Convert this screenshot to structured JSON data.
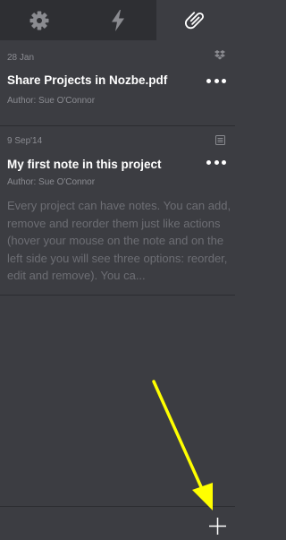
{
  "tabs": [
    {
      "icon": "gear-icon",
      "active": false
    },
    {
      "icon": "lightning-icon",
      "active": false
    },
    {
      "icon": "paperclip-icon",
      "active": true
    }
  ],
  "notes": [
    {
      "date": "28 Jan",
      "type_icon": "dropbox-icon",
      "title": "Share Projects in Nozbe.pdf",
      "author": "Author: Sue O'Connor"
    },
    {
      "date": "9 Sep'14",
      "type_icon": "note-icon",
      "title": "My first note in this project",
      "author": "Author: Sue O'Connor",
      "body": "Every project can have notes. You can add, remove and reorder them just like actions (hover your mouse on the note and on the left side you will see three options: reorder, edit and remove). You ca..."
    }
  ],
  "colors": {
    "background": "#3c3d42",
    "tabbar": "#2e2f33",
    "muted_text": "#8b8c92",
    "body_text": "#6d6e74",
    "annotation_arrow": "#ffff00"
  },
  "bottom": {
    "add_icon": "plus-icon"
  }
}
